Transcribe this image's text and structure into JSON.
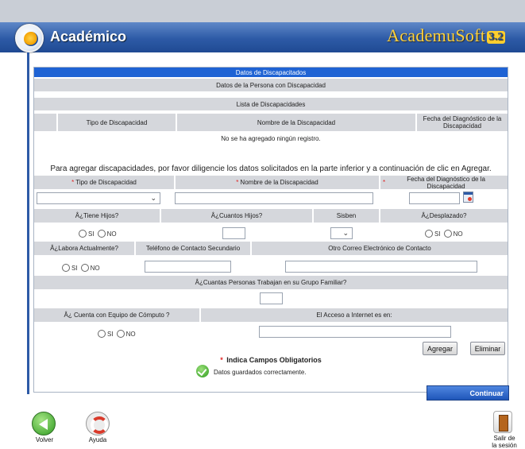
{
  "header": {
    "app_title": "Académico",
    "brand": "AcademuSoft",
    "brand_version": "3.2"
  },
  "form": {
    "section_title": "Datos de Discapacitados",
    "person_title": "Datos de la Persona con Discapacidad",
    "list_title": "Lista de Discapacidades",
    "table_headers": [
      "Tipo de Discapacidad",
      "Nombre de la Discapacidad",
      "Fecha del Diagnóstico de la Discapacidad"
    ],
    "empty_message": "No se ha agregado ningún registro.",
    "instructions": "Para agregar discapacidades, por favor diligencie los datos solicitados en la parte inferior y a continuación de clic en Agregar.",
    "required_mark": "*",
    "labels": {
      "tipo": "Tipo de Discapacidad",
      "nombre": "Nombre de la Discapacidad",
      "fecha": "Fecha del Diagnóstico de la Discapacidad",
      "hijos": "Â¿Tiene Hijos?",
      "cuantos_hijos": "Â¿Cuantos Hijos?",
      "sisben": "Sisben",
      "desplazado": "Â¿Desplazado?",
      "labora": "Â¿Labora Actualmente?",
      "telefono": "Teléfono de Contacto Secundario",
      "correo": "Otro Correo Electrónico de Contacto",
      "personas": "Â¿Cuantas Personas Trabajan en su Grupo Familiar?",
      "equipo": "Â¿ Cuenta con Equipo de Cómputo ?",
      "internet": "El Acceso a Internet es en:"
    },
    "radio_si": "SI",
    "radio_no": "NO",
    "buttons": {
      "agregar": "Agregar",
      "eliminar": "Eliminar"
    },
    "required_note": "Indica Campos Obligatorios",
    "saved_message": "Datos guardados correctamente."
  },
  "continuar": "Continuar",
  "nav": {
    "volver": "Volver",
    "ayuda": "Ayuda",
    "salir_line1": "Salir de",
    "salir_line2": "la sesión"
  }
}
